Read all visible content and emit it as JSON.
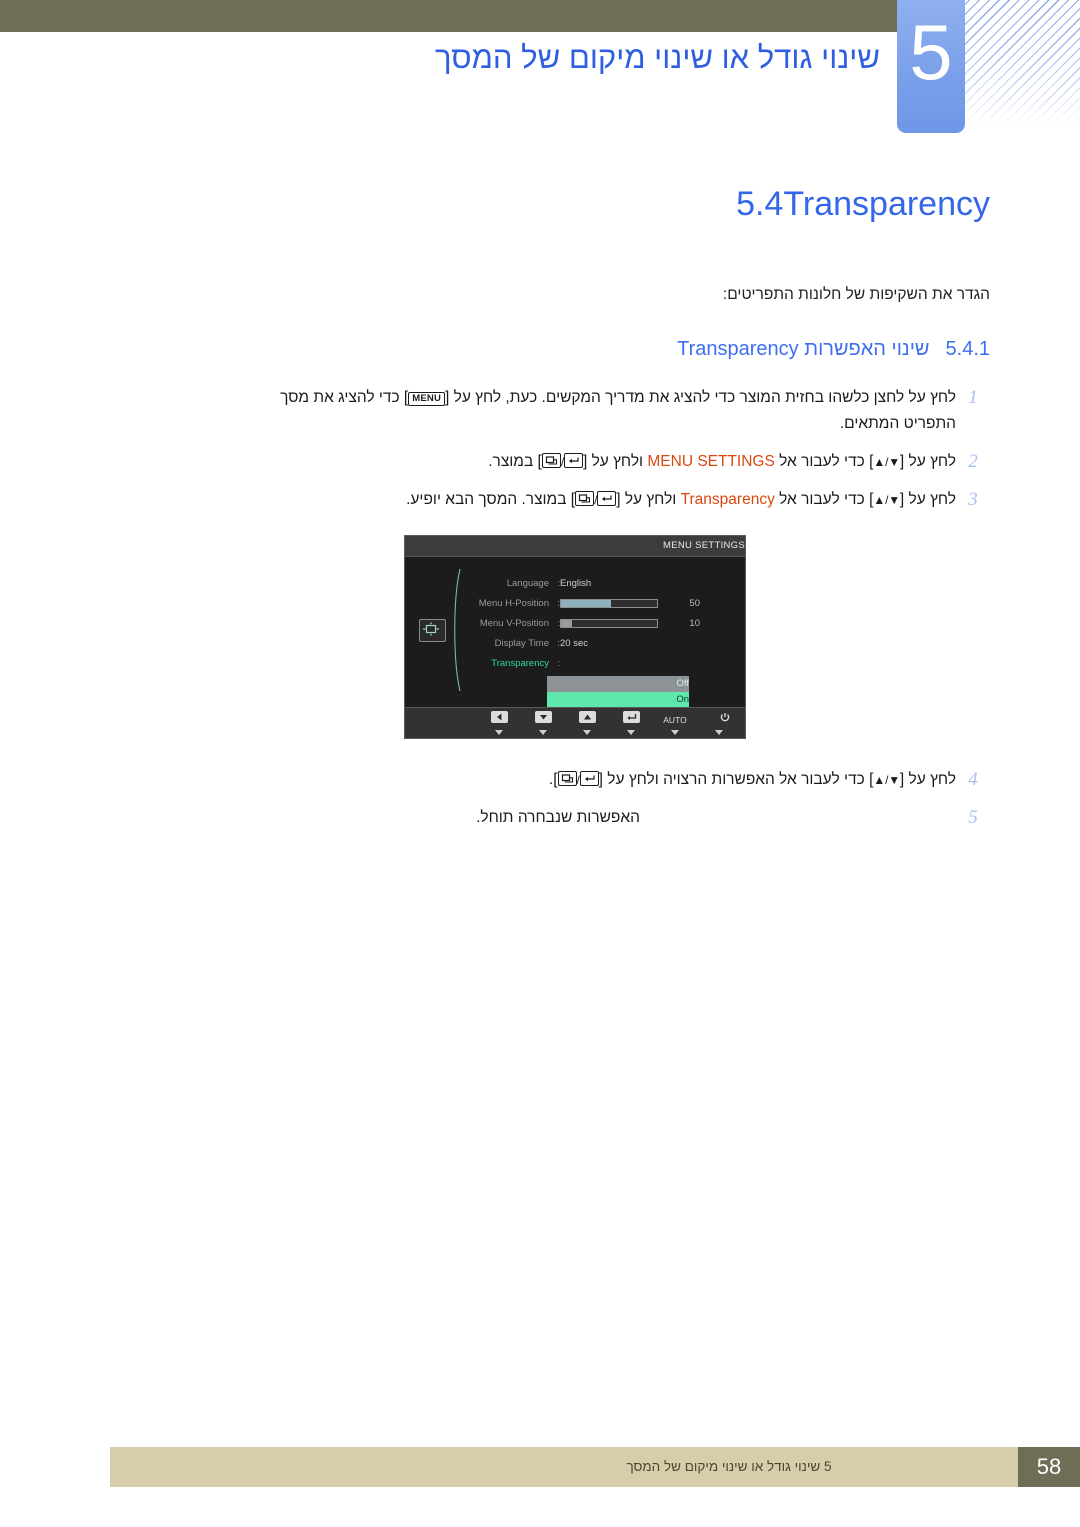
{
  "header": {
    "chapter_number": "5",
    "chapter_title": "שינוי גודל או שינוי מיקום של המסך"
  },
  "section": {
    "number": "5.4",
    "title": "Transparency",
    "description": "הגדר את השקיפות של חלונות התפריטים:"
  },
  "subsection": {
    "number": "5.4.1",
    "title_he": "שינוי האפשרות",
    "title_en": "Transparency"
  },
  "steps": [
    {
      "num": "1",
      "line1_a": "לחץ על לחצן כלשהו בחזית המוצר כדי להציג את מדריך המקשים. כעת, לחץ על [",
      "key": "MENU",
      "line1_b": "] כדי להציג את מסך",
      "line2": "התפריט המתאים."
    },
    {
      "num": "2",
      "text_a": "לחץ על [",
      "keys_updown": "▲/▼",
      "text_b": "] כדי לעבור אל",
      "highlight": "MENU SETTINGS",
      "text_c": "ולחץ על [",
      "keys_enter": "enter",
      "text_d": "] במוצר."
    },
    {
      "num": "3",
      "text_a": "לחץ על [",
      "keys_updown": "▲/▼",
      "text_b": "] כדי לעבור אל",
      "highlight": "Transparency",
      "text_c": "ולחץ על [",
      "keys_enter": "enter",
      "text_d": "] במוצר. המסך הבא יופיע."
    },
    {
      "num": "4",
      "text_a": "לחץ על [",
      "keys_updown": "▲/▼",
      "text_b": "] כדי לעבור אל האפשרות הרצויה ולחץ על [",
      "keys_enter": "enter",
      "text_d": "]."
    },
    {
      "num": "5",
      "text": "האפשרות שנבחרה תוחל."
    }
  ],
  "osd": {
    "title": "MENU SETTINGS",
    "rows": [
      {
        "label": "Language",
        "colon": ":",
        "type": "text",
        "value": "English"
      },
      {
        "label": "Menu H-Position",
        "colon": ":",
        "type": "bar",
        "value": "50",
        "fill_percent": 52,
        "fill_color": "#8fb0bd"
      },
      {
        "label": "Menu V-Position",
        "colon": ":",
        "type": "bar",
        "value": "10",
        "fill_percent": 11,
        "fill_color": "#9a9a9a"
      },
      {
        "label": "Display Time",
        "colon": ":",
        "type": "text",
        "value": "20 sec"
      },
      {
        "label": "Transparency",
        "colon": ":",
        "type": "dropdown",
        "value": "Off",
        "active": true
      }
    ],
    "dropdown_options": [
      "Off",
      "On"
    ],
    "dropdown_selected": "On",
    "category_icon": "menu-settings-icon",
    "buttons": [
      {
        "name": "left-arrow-icon",
        "label": ""
      },
      {
        "name": "down-arrow-icon",
        "label": ""
      },
      {
        "name": "up-arrow-icon",
        "label": ""
      },
      {
        "name": "enter-icon",
        "label": ""
      },
      {
        "name": "auto-button",
        "label": "AUTO"
      },
      {
        "name": "power-icon",
        "label": ""
      }
    ]
  },
  "footer": {
    "page_number": "58",
    "text": "5 שינוי גודל או שינוי מיקום של המסך"
  },
  "colors": {
    "header_bar": "#6e6d56",
    "chapter_badge": "#7ba0ea",
    "title_blue": "#3366e8",
    "highlight_orange": "#d9480f",
    "step_number": "#aac0f2",
    "footer_band": "#d8cdaa",
    "osd_green": "#2fd89b",
    "osd_on_bg": "#5fe8ad"
  }
}
